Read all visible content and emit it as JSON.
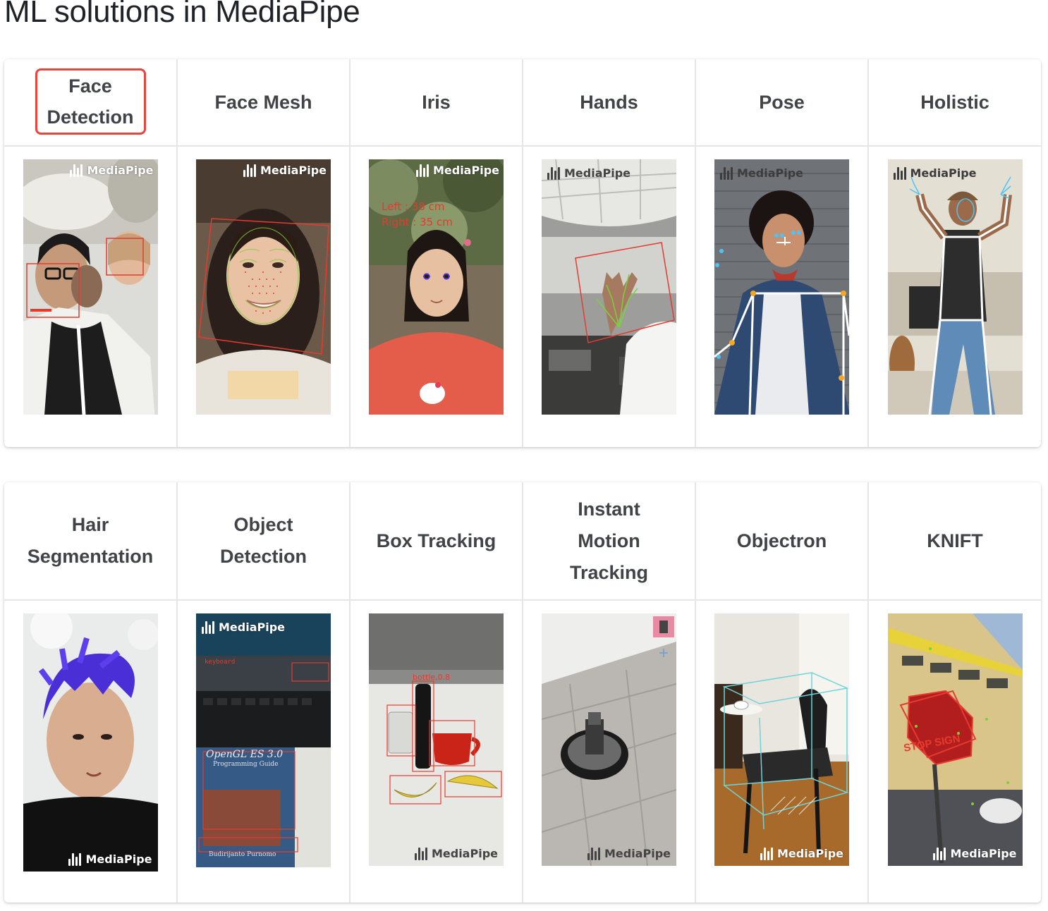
{
  "page": {
    "title": "ML solutions in MediaPipe"
  },
  "brand": {
    "name": "MediaPipe"
  },
  "colors": {
    "highlight": "#e8463a",
    "overlay_red": "#e53b2f",
    "overlay_green": "#7bd13b"
  },
  "rows": [
    {
      "solutions": [
        {
          "name": "Face Detection",
          "highlighted": true
        },
        {
          "name": "Face Mesh"
        },
        {
          "name": "Iris",
          "overlay": [
            "Left : 38 cm",
            "Right : 35 cm"
          ]
        },
        {
          "name": "Hands"
        },
        {
          "name": "Pose"
        },
        {
          "name": "Holistic"
        }
      ]
    },
    {
      "solutions": [
        {
          "name": "Hair Segmentation"
        },
        {
          "name": "Object Detection",
          "overlay": [
            "OpenGL ES 3.0",
            "Programming Guide",
            "Budirijanto Purnomo"
          ]
        },
        {
          "name": "Box Tracking",
          "overlay": [
            "bottle,0.8"
          ]
        },
        {
          "name": "Instant Motion Tracking"
        },
        {
          "name": "Objectron"
        },
        {
          "name": "KNIFT",
          "overlay": [
            "STOP SIGN"
          ]
        }
      ]
    }
  ]
}
